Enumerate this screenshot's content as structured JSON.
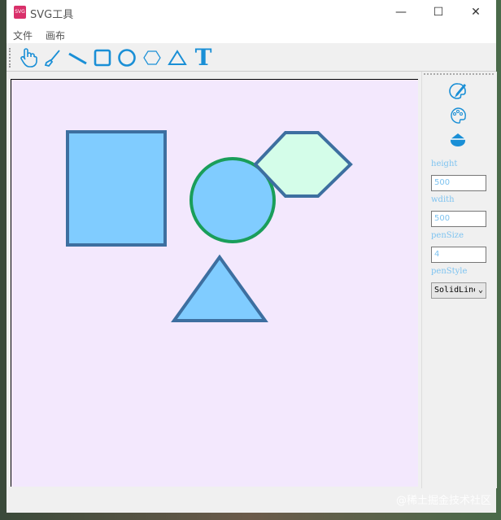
{
  "window": {
    "title": "SVG工具",
    "icon": "svg-file-icon",
    "icon_text": "SVG"
  },
  "menu": [
    "文件",
    "画布"
  ],
  "toolbar": [
    "hand-icon",
    "brush-icon",
    "line-icon",
    "rectangle-icon",
    "circle-icon",
    "hexagon-icon",
    "triangle-icon",
    "text-icon"
  ],
  "toolbar_text_glyph": "T",
  "side": {
    "icons": [
      "palette-brush-icon",
      "palette-icon",
      "paint-bucket-icon"
    ],
    "height_label": "height",
    "height_value": "500",
    "width_label": "wdith",
    "width_value": "500",
    "pensize_label": "penSize",
    "pensize_value": "4",
    "penstyle_label": "penStyle",
    "penstyle_value": "SolidLine"
  },
  "colors": {
    "canvas": "#f3e8fd",
    "stroke": "#3d6fa0",
    "fill": "#80ccff",
    "circle_stroke": "#1a9e5a",
    "hex_fill": "#d4fde9",
    "accent": "#1a8fd6"
  },
  "watermark": "@稀土掘金技术社区"
}
